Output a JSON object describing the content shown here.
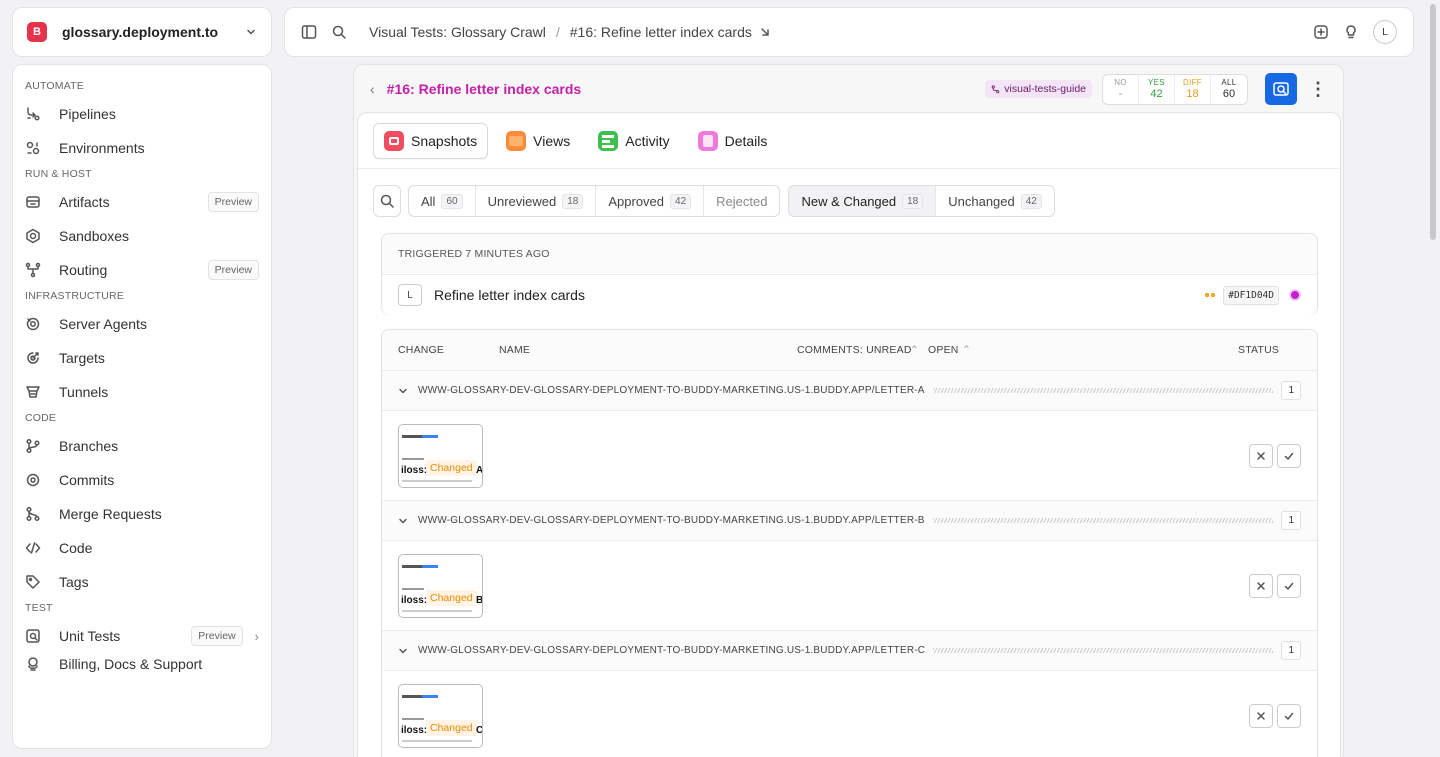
{
  "workspace": {
    "logo_letter": "B",
    "name": "glossary.deployment.to",
    "logo_color": "#e5334b"
  },
  "sidebar": {
    "sections": [
      {
        "title": "AUTOMATE",
        "items": [
          {
            "label": "Pipelines",
            "icon": "pipeline-icon"
          },
          {
            "label": "Environments",
            "icon": "environments-icon"
          }
        ]
      },
      {
        "title": "RUN & HOST",
        "items": [
          {
            "label": "Artifacts",
            "icon": "archive-icon",
            "badge": "Preview"
          },
          {
            "label": "Sandboxes",
            "icon": "sandbox-icon"
          },
          {
            "label": "Routing",
            "icon": "routing-icon",
            "badge": "Preview"
          }
        ]
      },
      {
        "title": "INFRASTRUCTURE",
        "items": [
          {
            "label": "Server Agents",
            "icon": "agent-icon"
          },
          {
            "label": "Targets",
            "icon": "target-icon"
          },
          {
            "label": "Tunnels",
            "icon": "tunnel-icon"
          }
        ]
      },
      {
        "title": "CODE",
        "items": [
          {
            "label": "Branches",
            "icon": "branch-icon"
          },
          {
            "label": "Commits",
            "icon": "commit-icon"
          },
          {
            "label": "Merge Requests",
            "icon": "merge-icon"
          },
          {
            "label": "Code",
            "icon": "code-icon"
          },
          {
            "label": "Tags",
            "icon": "tag-icon"
          }
        ]
      },
      {
        "title": "TEST",
        "items": [
          {
            "label": "Unit Tests",
            "icon": "test-icon",
            "badge": "Preview"
          }
        ]
      }
    ],
    "footer": "Billing, Docs & Support"
  },
  "topbar": {
    "crumb1": "Visual Tests: Glossary Crawl",
    "crumb2": "#16: Refine letter index cards",
    "avatar": "L"
  },
  "main": {
    "title": "#16: Refine letter index cards",
    "tag": "visual-tests-guide",
    "stats": [
      {
        "key": "NO",
        "value": "-",
        "color": "#999999"
      },
      {
        "key": "YES",
        "value": "42",
        "color": "#2e9e3e"
      },
      {
        "key": "DIFF",
        "value": "18",
        "color": "#e89a1a"
      },
      {
        "key": "ALL",
        "value": "60",
        "color": "#333333"
      }
    ],
    "tabs": [
      {
        "label": "Snapshots"
      },
      {
        "label": "Views"
      },
      {
        "label": "Activity"
      },
      {
        "label": "Details"
      }
    ],
    "filters": [
      {
        "label": "All",
        "count": "60"
      },
      {
        "label": "Unreviewed",
        "count": "18"
      },
      {
        "label": "Approved",
        "count": "42"
      },
      {
        "label": "Rejected"
      },
      {
        "label": "New & Changed",
        "count": "18"
      },
      {
        "label": "Unchanged",
        "count": "42"
      }
    ],
    "trigger": {
      "header": "TRIGGERED 7 MINUTES AGO",
      "avatar": "L",
      "message": "Refine letter index cards",
      "hash": "#DF1D04D"
    },
    "table": {
      "columns": {
        "change": "CHANGE",
        "name": "NAME",
        "comments": "COMMENTS: UNREAD",
        "open": "OPEN",
        "status": "STATUS"
      },
      "groups": [
        {
          "url": "WWW-GLOSSARY-DEV-GLOSSARY-DEPLOYMENT-TO-BUDDY-MARKETING.US-1.BUDDY.APP/LETTER-A",
          "count": "1",
          "thumb_brand": "ossary",
          "thumb_big": "iloss:",
          "thumb_letter": "A",
          "thumb_label": "Changed"
        },
        {
          "url": "WWW-GLOSSARY-DEV-GLOSSARY-DEPLOYMENT-TO-BUDDY-MARKETING.US-1.BUDDY.APP/LETTER-B",
          "count": "1",
          "thumb_brand": "ossary",
          "thumb_big": "iloss:",
          "thumb_letter": "B",
          "thumb_label": "Changed"
        },
        {
          "url": "WWW-GLOSSARY-DEV-GLOSSARY-DEPLOYMENT-TO-BUDDY-MARKETING.US-1.BUDDY.APP/LETTER-C",
          "count": "1",
          "thumb_brand": "ossary",
          "thumb_big": "iloss:",
          "thumb_letter": "C",
          "thumb_label": "Changed"
        }
      ]
    }
  }
}
